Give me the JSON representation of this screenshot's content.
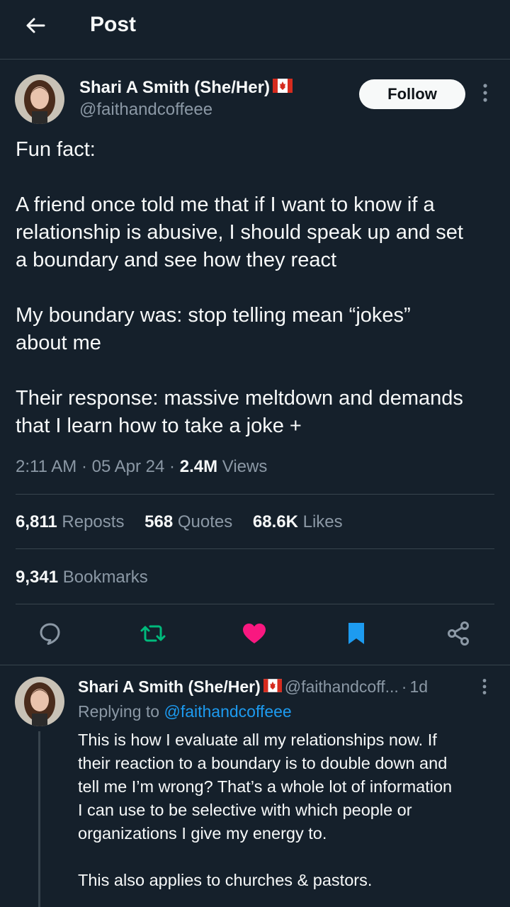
{
  "header": {
    "title": "Post"
  },
  "post": {
    "author_name": "Shari A Smith (She/Her)",
    "handle": "@faithandcoffeee",
    "follow_label": "Follow",
    "text_lines": [
      "Fun fact:",
      "",
      "A friend once told me that if I want to know if a",
      "relationship is abusive, I should speak up and set",
      "a boundary and see how they react",
      "",
      "My boundary was: stop telling mean “jokes”",
      "about me",
      "",
      "Their response: massive meltdown and demands",
      "that I learn how to take a joke +"
    ],
    "time": "2:11 AM",
    "date": "05 Apr 24",
    "views_count": "2.4M",
    "views_label": "Views",
    "sep": "·"
  },
  "stats": {
    "reposts_count": "6,811",
    "reposts_label": "Reposts",
    "quotes_count": "568",
    "quotes_label": "Quotes",
    "likes_count": "68.6K",
    "likes_label": "Likes",
    "bookmarks_count": "9,341",
    "bookmarks_label": "Bookmarks"
  },
  "icons": {
    "back": "arrow-left-icon",
    "more": "more-vertical-icon",
    "reply": "comment-bubble-icon",
    "repost": "repost-icon",
    "like": "heart-icon",
    "bookmark": "bookmark-icon",
    "share": "share-icon",
    "flag": "canada-flag-icon"
  },
  "colors": {
    "background": "#15202b",
    "repost_active": "#00ba7c",
    "like_active": "#f91880",
    "bookmark_active": "#1d9bf0",
    "link": "#1d9bf0",
    "secondary_text": "#8b98a5"
  },
  "reply": {
    "author_name": "Shari A Smith (She/Her)",
    "handle": "@faithandcoff...",
    "sep": "·",
    "age": "1d",
    "replying_prefix": "Replying to",
    "replying_handle": "@faithandcoffeee",
    "text_lines": [
      "This is how I evaluate all my relationships now. If",
      "their reaction to a boundary is to double down and",
      "tell me I’m wrong? That’s a whole lot of information",
      "I can use to be selective with which people or",
      "organizations I give my energy to.",
      "",
      "This also applies to churches & pastors."
    ]
  }
}
